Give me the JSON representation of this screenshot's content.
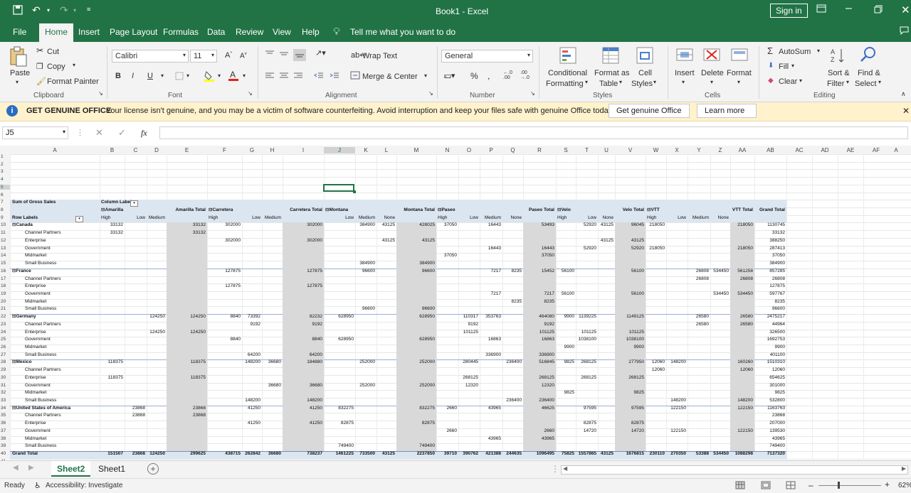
{
  "window": {
    "title": "Book1  -  Excel",
    "sign_in": "Sign in"
  },
  "tabs": [
    "File",
    "Home",
    "Insert",
    "Page Layout",
    "Formulas",
    "Data",
    "Review",
    "View",
    "Help"
  ],
  "tell_me": "Tell me what you want to do",
  "ribbon": {
    "clipboard": {
      "paste": "Paste",
      "cut": "Cut",
      "copy": "Copy",
      "format_painter": "Format Painter",
      "group": "Clipboard"
    },
    "font": {
      "name": "Calibri",
      "size": "11",
      "bold": "B",
      "italic": "I",
      "underline": "U",
      "group": "Font"
    },
    "alignment": {
      "wrap_text": "Wrap Text",
      "merge_center": "Merge & Center",
      "group": "Alignment"
    },
    "number": {
      "format": "General",
      "percent": "%",
      "group": "Number"
    },
    "styles": {
      "conditional": "Conditional",
      "formatting": "Formatting",
      "format_as": "Format as",
      "table": "Table",
      "cell": "Cell",
      "styles": "Styles",
      "group": "Styles"
    },
    "cells": {
      "insert": "Insert",
      "delete": "Delete",
      "format": "Format",
      "group": "Cells"
    },
    "editing": {
      "autosum": "AutoSum",
      "fill": "Fill",
      "clear": "Clear",
      "sort": "Sort &",
      "filter": "Filter",
      "find": "Find &",
      "select": "Select",
      "group": "Editing"
    }
  },
  "notification": {
    "title": "GET GENUINE OFFICE",
    "message": "Your license isn't genuine, and you may be a victim of software counterfeiting. Avoid interruption and keep your files safe with genuine Office today.",
    "btn_genuine": "Get genuine Office",
    "btn_learn": "Learn more"
  },
  "formula_bar": {
    "name_box": "J5",
    "fx": "fx",
    "value": ""
  },
  "columns": [
    "A",
    "B",
    "C",
    "D",
    "E",
    "F",
    "G",
    "H",
    "I",
    "J",
    "K",
    "L",
    "M",
    "N",
    "O",
    "P",
    "Q",
    "R",
    "S",
    "T",
    "U",
    "V",
    "W",
    "X",
    "Y",
    "Z",
    "AA",
    "AB",
    "AC",
    "AD",
    "AE",
    "AF",
    "A"
  ],
  "rows": [
    "1",
    "2",
    "3",
    "4",
    "5",
    "6",
    "7",
    "8",
    "9",
    "10",
    "11",
    "12",
    "13",
    "14",
    "15",
    "16",
    "17",
    "18",
    "19",
    "20",
    "21",
    "22",
    "23",
    "24",
    "25",
    "26",
    "27",
    "28",
    "29",
    "30",
    "31",
    "32",
    "33",
    "34",
    "35",
    "36",
    "37",
    "38",
    "39",
    "40",
    "41"
  ],
  "pivot": {
    "sum_label": "Sum of Gross Sales",
    "col_labels": "Column Labels",
    "row_labels": "Row Labels",
    "segments": [
      "Amarilla",
      "Carretera",
      "Montana",
      "Paseo",
      "Velo",
      "VTT"
    ],
    "totals": [
      "Amarilla Total",
      "Carretera Total",
      "Montana Total",
      "Paseo Total",
      "Velo Total",
      "VTT Total",
      "Grand Total"
    ],
    "subheaders": [
      "High",
      "Low",
      "Medium",
      "High",
      "Low",
      "Medium",
      "Low",
      "Medium",
      "None",
      "High",
      "Low",
      "Medium",
      "None",
      "High",
      "Low",
      "None",
      "High",
      "Low",
      "Medium",
      "None"
    ],
    "data_rows": [
      {
        "label": "Canada",
        "bold": true,
        "v": {
          "B": "33132",
          "E": "33132",
          "F": "302000",
          "I": "302000",
          "K": "384900",
          "L": "43125",
          "M": "428025",
          "N": "37050",
          "P": "16443",
          "R": "53493",
          "T": "52920",
          "U": "43125",
          "V": "96045",
          "W": "218050",
          "AA": "218050",
          "AB": "1130745"
        }
      },
      {
        "label": "Channel Partners",
        "v": {
          "B": "33132",
          "E": "33132",
          "AB": "33132"
        }
      },
      {
        "label": "Enterprise",
        "v": {
          "F": "302000",
          "I": "302000",
          "L": "43125",
          "M": "43125",
          "U": "43125",
          "V": "43125",
          "AB": "388250"
        }
      },
      {
        "label": "Government",
        "v": {
          "P": "16443",
          "R": "16443",
          "T": "52920",
          "V": "52920",
          "W": "218050",
          "AA": "218050",
          "AB": "287413"
        }
      },
      {
        "label": "Midmarket",
        "v": {
          "N": "37050",
          "R": "37050",
          "AB": "37050"
        }
      },
      {
        "label": "Small Business",
        "v": {
          "K": "384900",
          "M": "384900",
          "AB": "384900"
        }
      },
      {
        "label": "France",
        "bold": true,
        "v": {
          "F": "127875",
          "I": "127875",
          "K": "96600",
          "M": "96600",
          "P": "7217",
          "Q": "8235",
          "R": "15452",
          "S": "56100",
          "V": "56100",
          "Y": "26808",
          "Z": "534450",
          "AA": "561258",
          "AB": "857285"
        }
      },
      {
        "label": "Channel Partners",
        "v": {
          "Y": "26808",
          "AA": "26808",
          "AB": "26808"
        }
      },
      {
        "label": "Enterprise",
        "v": {
          "F": "127875",
          "I": "127875",
          "AB": "127875"
        }
      },
      {
        "label": "Government",
        "v": {
          "P": "7217",
          "R": "7217",
          "S": "56100",
          "V": "56100",
          "Z": "534450",
          "AA": "534450",
          "AB": "597767"
        }
      },
      {
        "label": "Midmarket",
        "v": {
          "Q": "8235",
          "R": "8235",
          "AB": "8235"
        }
      },
      {
        "label": "Small Business",
        "v": {
          "K": "96600",
          "M": "96600",
          "AB": "96600"
        }
      },
      {
        "label": "Germany",
        "bold": true,
        "v": {
          "D": "124250",
          "E": "124250",
          "F": "8840",
          "G": "73392",
          "I": "82232",
          "J": "628950",
          "M": "628950",
          "O": "110317",
          "P": "353763",
          "R": "464080",
          "S": "9900",
          "T": "1139225",
          "V": "1149125",
          "Y": "26580",
          "AA": "26580",
          "AB": "2475217"
        }
      },
      {
        "label": "Channel Partners",
        "v": {
          "G": "9192",
          "I": "9192",
          "O": "9192",
          "R": "9192",
          "Y": "26580",
          "AA": "26580",
          "AB": "44964"
        }
      },
      {
        "label": "Enterprise",
        "v": {
          "D": "124250",
          "E": "124250",
          "O": "101125",
          "R": "101125",
          "T": "101125",
          "V": "101125",
          "AB": "326500"
        }
      },
      {
        "label": "Government",
        "v": {
          "F": "8840",
          "I": "8840",
          "J": "628950",
          "M": "628950",
          "P": "16863",
          "R": "16863",
          "T": "1038100",
          "V": "1038100",
          "AB": "1692753"
        }
      },
      {
        "label": "Midmarket",
        "v": {
          "S": "9900",
          "V": "9900",
          "AB": "9900"
        }
      },
      {
        "label": "Small Business",
        "v": {
          "G": "64200",
          "I": "64200",
          "P": "336900",
          "R": "336900",
          "AB": "401100"
        }
      },
      {
        "label": "Mexico",
        "bold": true,
        "v": {
          "B": "118375",
          "E": "118375",
          "G": "148200",
          "H": "36680",
          "I": "184880",
          "K": "252000",
          "M": "252000",
          "O": "280445",
          "Q": "236400",
          "R": "516845",
          "S": "9825",
          "T": "268125",
          "V": "277950",
          "W": "12060",
          "X": "148200",
          "AA": "160260",
          "AB": "1510310"
        }
      },
      {
        "label": "Channel Partners",
        "v": {
          "W": "12060",
          "AA": "12060",
          "AB": "12060"
        }
      },
      {
        "label": "Enterprise",
        "v": {
          "B": "118375",
          "E": "118375",
          "O": "268125",
          "R": "268125",
          "T": "268125",
          "V": "268125",
          "AB": "654625"
        }
      },
      {
        "label": "Government",
        "v": {
          "H": "36680",
          "I": "36680",
          "K": "252000",
          "M": "252000",
          "O": "12320",
          "R": "12320",
          "AB": "301000"
        }
      },
      {
        "label": "Midmarket",
        "v": {
          "S": "9825",
          "V": "9825",
          "AB": "9825"
        }
      },
      {
        "label": "Small Business",
        "v": {
          "G": "148200",
          "I": "148200",
          "Q": "236400",
          "R": "236400",
          "X": "148200",
          "AA": "148200",
          "AB": "532800"
        }
      },
      {
        "label": "United States of America",
        "bold": true,
        "v": {
          "C": "23868",
          "E": "23868",
          "G": "41250",
          "I": "41250",
          "J": "832275",
          "M": "832275",
          "N": "2660",
          "P": "43965",
          "R": "46625",
          "T": "97595",
          "V": "97595",
          "X": "122150",
          "AA": "122150",
          "AB": "1163763"
        }
      },
      {
        "label": "Channel Partners",
        "v": {
          "C": "23868",
          "E": "23868",
          "AB": "23868"
        }
      },
      {
        "label": "Enterprise",
        "v": {
          "G": "41250",
          "I": "41250",
          "J": "82875",
          "M": "82875",
          "T": "82875",
          "V": "82875",
          "AB": "207000"
        }
      },
      {
        "label": "Government",
        "v": {
          "N": "2660",
          "R": "2660",
          "T": "14720",
          "V": "14720",
          "X": "122150",
          "AA": "122150",
          "AB": "139530"
        }
      },
      {
        "label": "Midmarket",
        "v": {
          "P": "43965",
          "R": "43965",
          "AB": "43965"
        }
      },
      {
        "label": "Small Business",
        "v": {
          "J": "749400",
          "M": "749400",
          "AB": "749400"
        }
      },
      {
        "label": "Grand Total",
        "bold": true,
        "v": {
          "B": "151507",
          "C": "23868",
          "D": "124250",
          "E": "299625",
          "F": "438715",
          "G": "262842",
          "H": "36680",
          "I": "738237",
          "J": "1461225",
          "K": "733500",
          "L": "43125",
          "M": "2237850",
          "N": "39710",
          "O": "390762",
          "P": "421388",
          "Q": "244635",
          "R": "1096495",
          "S": "75825",
          "T": "1557865",
          "U": "43125",
          "V": "1676815",
          "W": "230110",
          "X": "270350",
          "Y": "53388",
          "Z": "534450",
          "AA": "1088298",
          "AB": "7137320"
        }
      }
    ]
  },
  "sheets": [
    "Sheet2",
    "Sheet1"
  ],
  "status": {
    "ready": "Ready",
    "accessibility": "Accessibility: Investigate",
    "zoom": "62%"
  },
  "colors": {
    "accent": "#217346",
    "pivot_header": "#dce6f1",
    "total_col": "#d9d9d9",
    "notif_bg": "#fff2cc"
  }
}
